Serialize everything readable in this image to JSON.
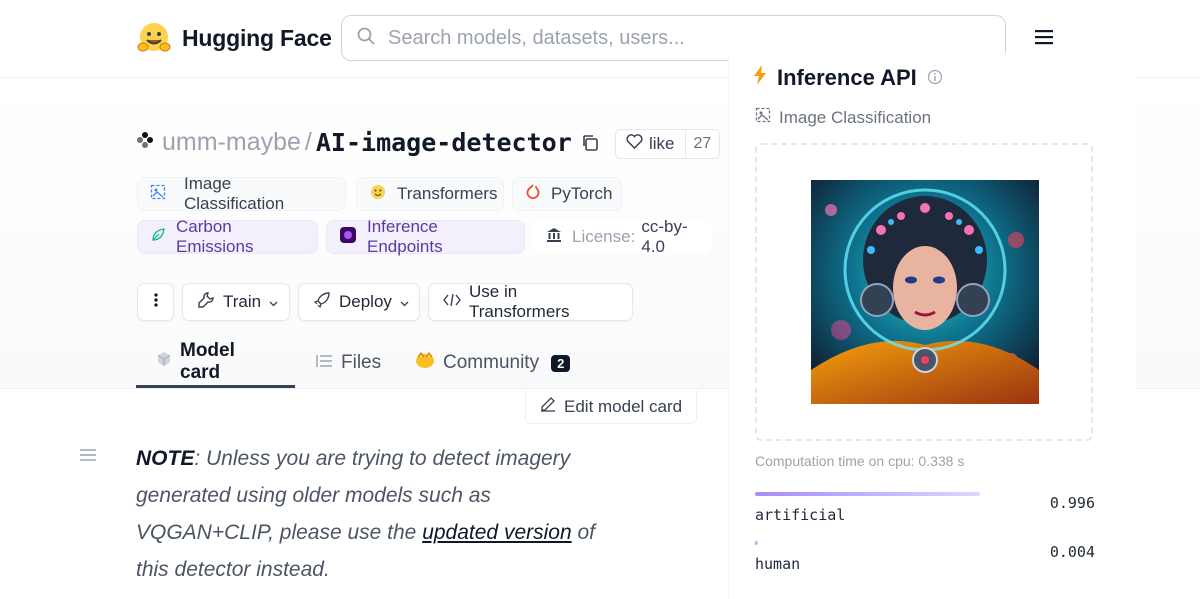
{
  "nav": {
    "brand": "Hugging Face",
    "search_placeholder": "Search models, datasets, users..."
  },
  "repo": {
    "owner": "umm-maybe",
    "separator": "/",
    "name": "AI-image-detector",
    "like_label": "like",
    "like_count": "27"
  },
  "tags": [
    {
      "label": "Image Classification"
    },
    {
      "label": "Transformers"
    },
    {
      "label": "PyTorch"
    },
    {
      "label": "Carbon Emissions"
    },
    {
      "label": "Inference Endpoints"
    },
    {
      "label_key": "License:",
      "label_value": "cc-by-4.0"
    }
  ],
  "actions": {
    "train": "Train",
    "deploy": "Deploy",
    "use_in": "Use in Transformers"
  },
  "tabs": [
    {
      "label": "Model card"
    },
    {
      "label": "Files"
    },
    {
      "label": "Community",
      "badge": "2"
    }
  ],
  "edit_model_card": "Edit model card",
  "note": {
    "bold": "NOTE",
    "text1": ": Unless you are trying to detect imagery generated using older models such as VQGAN+CLIP, please use the ",
    "link": "updated version",
    "text2": " of this detector instead."
  },
  "inference": {
    "title": "Inference API",
    "task": "Image Classification",
    "computation_time": "Computation time on cpu: 0.338 s",
    "results": [
      {
        "label": "artificial",
        "score": "0.996",
        "fraction": 0.996
      },
      {
        "label": "human",
        "score": "0.004",
        "fraction": 0.004
      }
    ]
  },
  "colors": {
    "accent_purple": "#a78bfa",
    "brand_yellow": "#fbbf24",
    "pytorch_orange": "#ee4c2c"
  }
}
